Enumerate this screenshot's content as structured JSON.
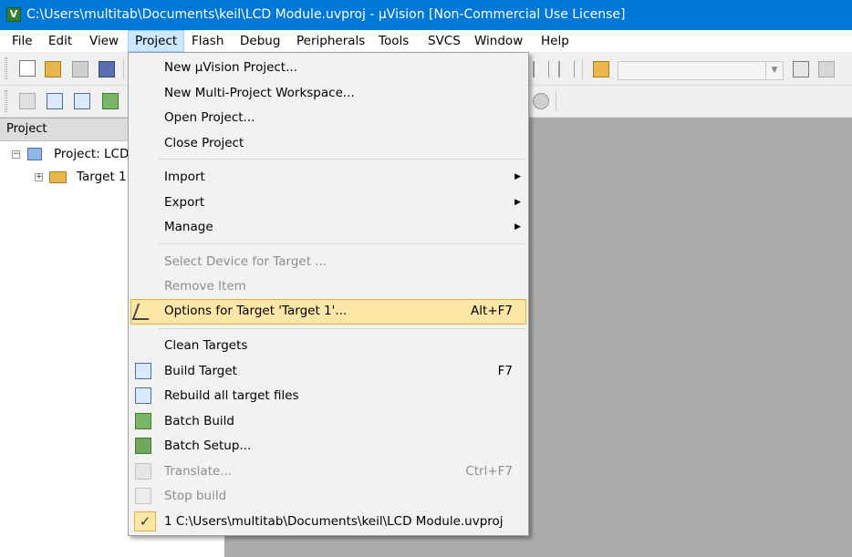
{
  "window": {
    "title": "C:\\Users\\multitab\\Documents\\keil\\LCD Module.uvproj - µVision  [Non-Commercial Use License]",
    "app_icon_letter": "V"
  },
  "menubar": {
    "items": [
      "File",
      "Edit",
      "View",
      "Project",
      "Flash",
      "Debug",
      "Peripherals",
      "Tools",
      "SVCS",
      "Window",
      "Help"
    ],
    "active": "Project"
  },
  "project_panel": {
    "header": "Project",
    "root_label": "Project: LCD",
    "child_label": "Target 1"
  },
  "project_menu": {
    "new_project": "New µVision Project...",
    "new_multi": "New Multi-Project Workspace...",
    "open_project": "Open Project...",
    "close_project": "Close Project",
    "import": "Import",
    "export": "Export",
    "manage": "Manage",
    "select_device": "Select Device for Target ...",
    "remove_item": "Remove Item",
    "options_target": "Options for Target 'Target 1'...",
    "options_shortcut": "Alt+F7",
    "clean_targets": "Clean Targets",
    "build_target": "Build Target",
    "build_shortcut": "F7",
    "rebuild_all": "Rebuild all target files",
    "batch_build": "Batch Build",
    "batch_setup": "Batch Setup...",
    "translate": "Translate...",
    "translate_shortcut": "Ctrl+F7",
    "stop_build": "Stop build",
    "recent_1": "1 C:\\Users\\multitab\\Documents\\keil\\LCD Module.uvproj",
    "recent_check": "✓",
    "submenu_arrow": "▶"
  },
  "colors": {
    "titlebar": "#0078d7",
    "highlight": "#fde7a7",
    "highlight_border": "#e5b13f",
    "menu_active": "#cce8ff"
  }
}
